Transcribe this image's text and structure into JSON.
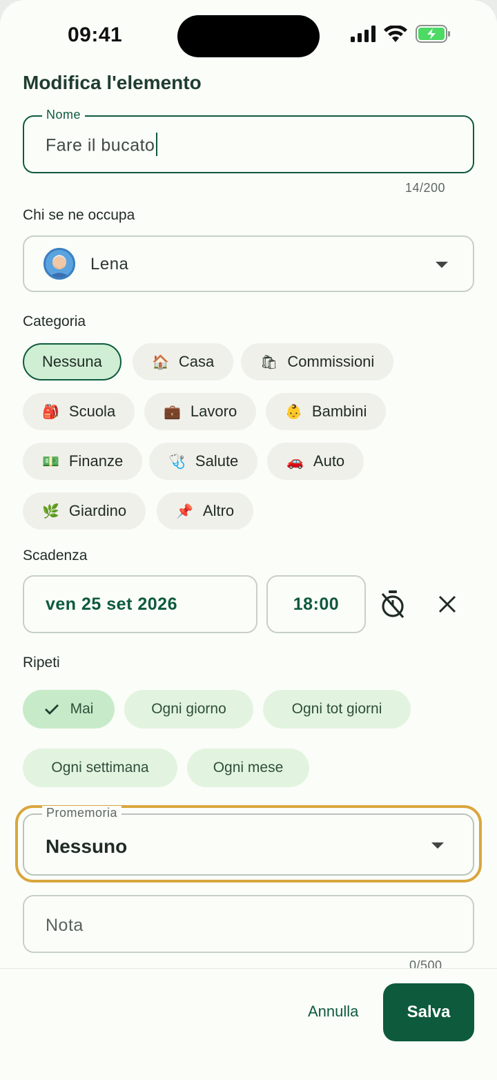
{
  "status_bar": {
    "time": "09:41"
  },
  "header": {
    "title": "Modifica l'elemento"
  },
  "name_field": {
    "label": "Nome",
    "value": "Fare il bucato",
    "counter": "14/200"
  },
  "assignee": {
    "label": "Chi se ne occupa",
    "value": "Lena"
  },
  "category": {
    "label": "Categoria",
    "chips": [
      {
        "label": "Nessuna",
        "emoji": ""
      },
      {
        "label": "Casa",
        "emoji": "🏠"
      },
      {
        "label": "Commissioni",
        "emoji": "🛍"
      },
      {
        "label": "Scuola",
        "emoji": "🎒"
      },
      {
        "label": "Lavoro",
        "emoji": "💼"
      },
      {
        "label": "Bambini",
        "emoji": "👶"
      },
      {
        "label": "Finanze",
        "emoji": "💵"
      },
      {
        "label": "Salute",
        "emoji": "🩺"
      },
      {
        "label": "Auto",
        "emoji": "🚗"
      },
      {
        "label": "Giardino",
        "emoji": "🌿"
      },
      {
        "label": "Altro",
        "emoji": "📌"
      }
    ],
    "selected": "Nessuna"
  },
  "deadline": {
    "label": "Scadenza",
    "date": "ven 25 set 2026",
    "time": "18:00"
  },
  "repeat": {
    "label": "Ripeti",
    "options": [
      "Mai",
      "Ogni giorno",
      "Ogni tot giorni",
      "Ogni settimana",
      "Ogni mese"
    ],
    "selected": "Mai"
  },
  "reminder": {
    "label": "Promemoria",
    "value": "Nessuno"
  },
  "note": {
    "placeholder": "Nota",
    "counter": "0/500"
  },
  "footer": {
    "cancel_label": "Annulla",
    "save_label": "Salva"
  },
  "colors": {
    "primary": "#0d5a3c",
    "selected_chip": "#cfeed3",
    "highlight": "#d9a63e"
  }
}
